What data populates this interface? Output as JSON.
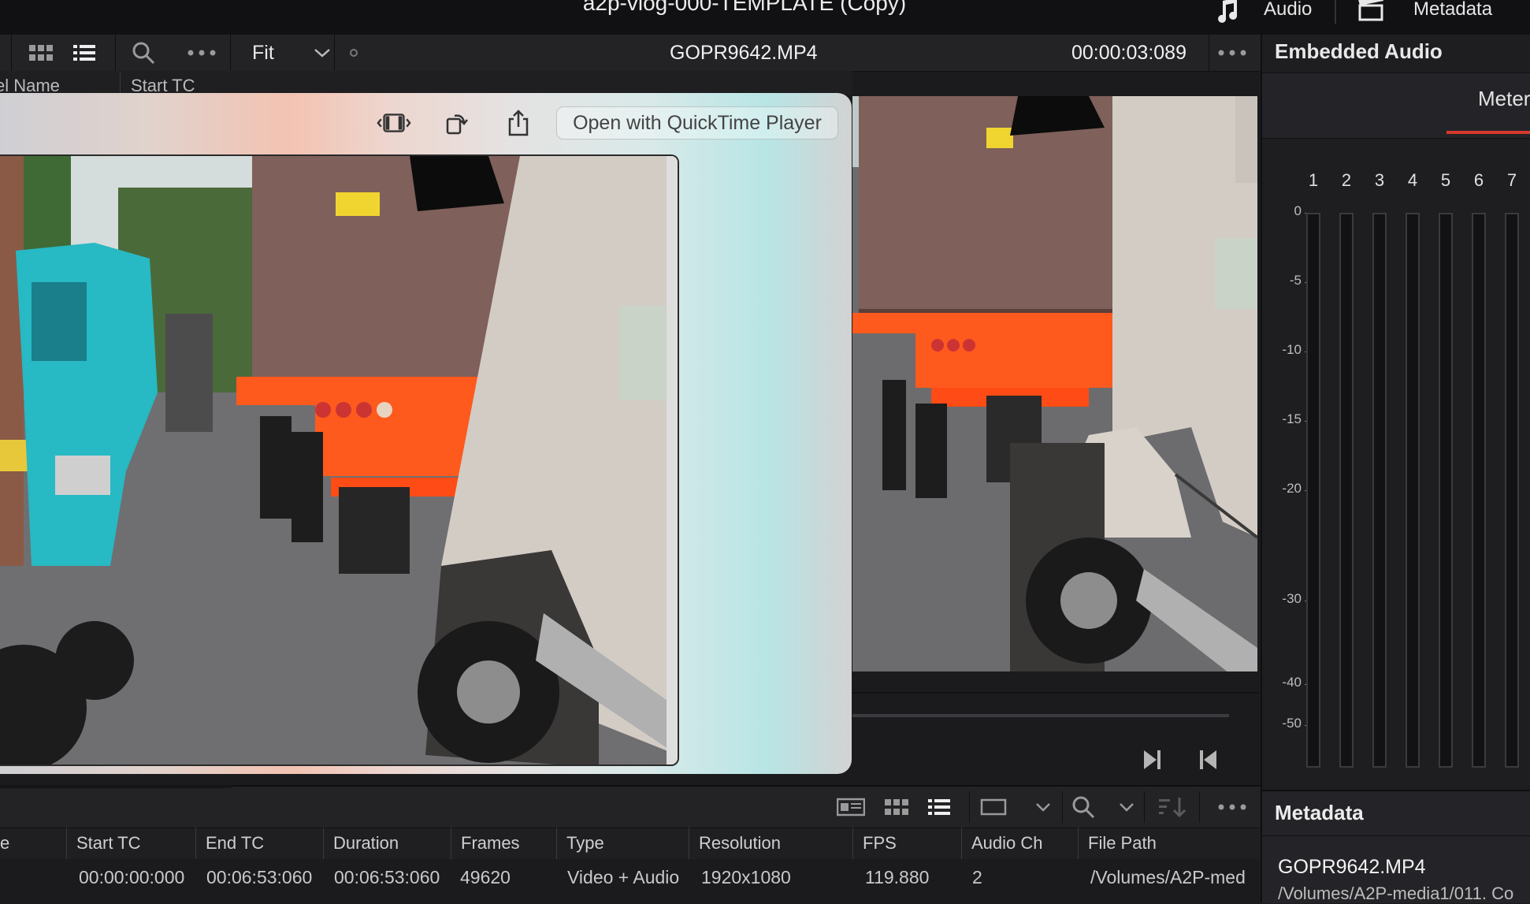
{
  "window": {
    "title": "a2p-vlog-000-TEMPLATE (Copy)"
  },
  "top_right": {
    "audio_label": "Audio",
    "metadata_label": "Metadata",
    "audio_icon": "music-note-icon",
    "metadata_icon": "clapper-icon"
  },
  "viewer_toolbar": {
    "zoom_value": "Fit",
    "clip_name": "GOPR9642.MP4",
    "timecode": "00:00:03:089",
    "icons": [
      "grid-view-icon",
      "list-view-icon",
      "search-icon",
      "more-icon",
      "chevron-down-icon",
      "more-icon"
    ]
  },
  "media_pool": {
    "columns": [
      "el Name",
      "Start TC"
    ]
  },
  "quicklook": {
    "open_button": "Open with QuickTime Player",
    "icons": [
      "trim-icon",
      "rotate-icon",
      "share-icon"
    ]
  },
  "right_panel": {
    "title": "Embedded Audio",
    "tab": "Meters",
    "channels": [
      "1",
      "2",
      "3",
      "4",
      "5",
      "6",
      "7"
    ],
    "scale": [
      "0",
      "-5",
      "-10",
      "-15",
      "-20",
      "-30",
      "-40",
      "-50"
    ]
  },
  "metadata_panel": {
    "title": "Metadata",
    "filename": "GOPR9642.MP4",
    "path": "/Volumes/A2P-media1/011. Co"
  },
  "transport": {
    "icons": [
      "next-frame-icon",
      "previous-frame-icon"
    ]
  },
  "browser": {
    "columns": [
      "e",
      "Start TC",
      "End TC",
      "Duration",
      "Frames",
      "Type",
      "Resolution",
      "FPS",
      "Audio Ch",
      "File Path"
    ],
    "rows": [
      [
        "",
        "00:00:00:000",
        "00:06:53:060",
        "00:06:53:060",
        "49620",
        "Video + Audio",
        "1920x1080",
        "119.880",
        "2",
        "/Volumes/A2P-med"
      ]
    ]
  }
}
